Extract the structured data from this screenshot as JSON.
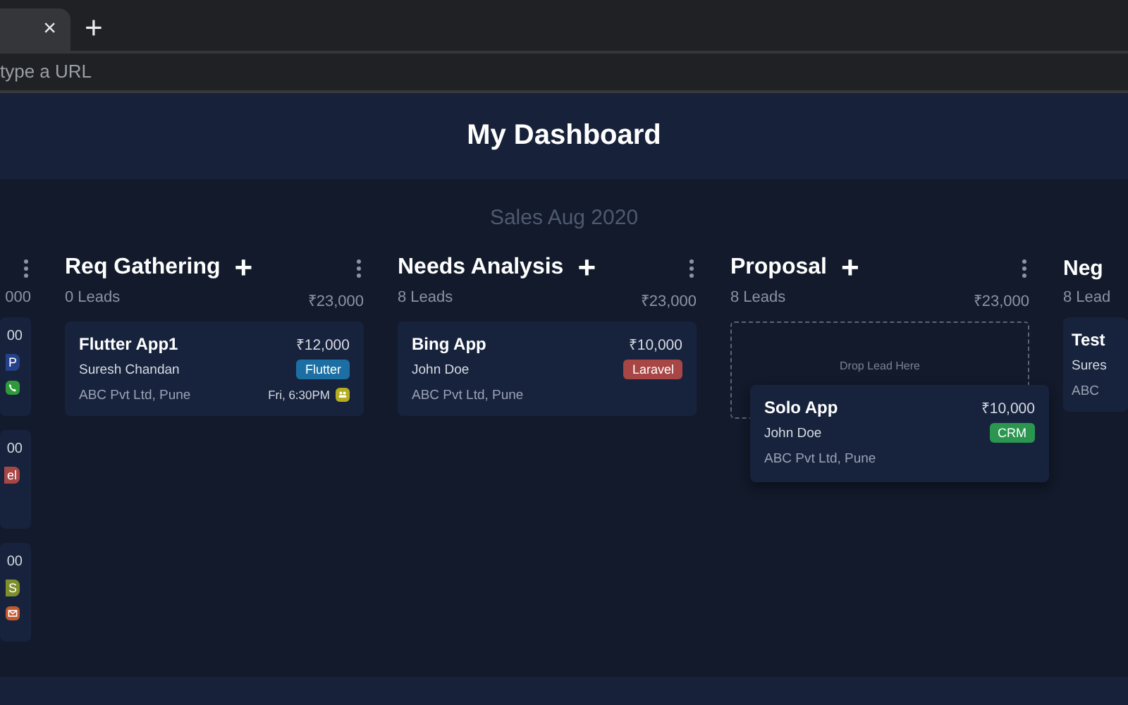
{
  "browser": {
    "address_placeholder": "type a URL",
    "tab_close": "×",
    "new_tab": "+"
  },
  "title": "My Dashboard",
  "board": {
    "title": "Sales Aug 2020",
    "columns": [
      {
        "kind": "clipped_left",
        "total": "000",
        "cards": [
          {
            "amount": "00",
            "tag": {
              "label": "P",
              "color": "#24418a"
            },
            "activity": {
              "kind": "call",
              "color": "#2f9a3a"
            }
          },
          {
            "amount": "00",
            "tag": {
              "label": "el",
              "color": "#a84545"
            }
          },
          {
            "amount": "00",
            "tag": {
              "label": "S",
              "color": "#7d8f2c"
            },
            "activity": {
              "kind": "email",
              "color": "#c0592e"
            }
          }
        ]
      },
      {
        "kind": "full",
        "name": "Req Gathering",
        "add": "+",
        "leads": "0 Leads",
        "total": "₹23,000",
        "cards": [
          {
            "title": "Flutter App1",
            "amount": "₹12,000",
            "person": "Suresh Chandan",
            "company": "ABC Pvt Ltd, Pune",
            "tag": {
              "label": "Flutter",
              "color": "#1b6fa3"
            },
            "time": "Fri, 6:30PM",
            "activity": {
              "kind": "meeting",
              "color": "#b3ad1f"
            }
          }
        ]
      },
      {
        "kind": "full",
        "name": "Needs Analysis",
        "add": "+",
        "leads": "8 Leads",
        "total": "₹23,000",
        "cards": [
          {
            "title": "Bing App",
            "amount": "₹10,000",
            "person": "John Doe",
            "company": "ABC Pvt Ltd, Pune",
            "tag": {
              "label": "Laravel",
              "color": "#a84545"
            }
          }
        ]
      },
      {
        "kind": "full",
        "name": "Proposal",
        "add": "+",
        "leads": "8 Leads",
        "total": "₹23,000",
        "drop_hint": "Drop Lead Here",
        "dragging": {
          "title": "Solo App",
          "amount": "₹10,000",
          "person": "John Doe",
          "company": "ABC Pvt Ltd, Pune",
          "tag": {
            "label": "CRM",
            "color": "#2a9650"
          }
        }
      },
      {
        "kind": "clipped_right",
        "name": "Neg",
        "leads": "8 Lead",
        "cards": [
          {
            "title": "Test",
            "person": "Sures",
            "company": "ABC"
          }
        ]
      }
    ]
  }
}
